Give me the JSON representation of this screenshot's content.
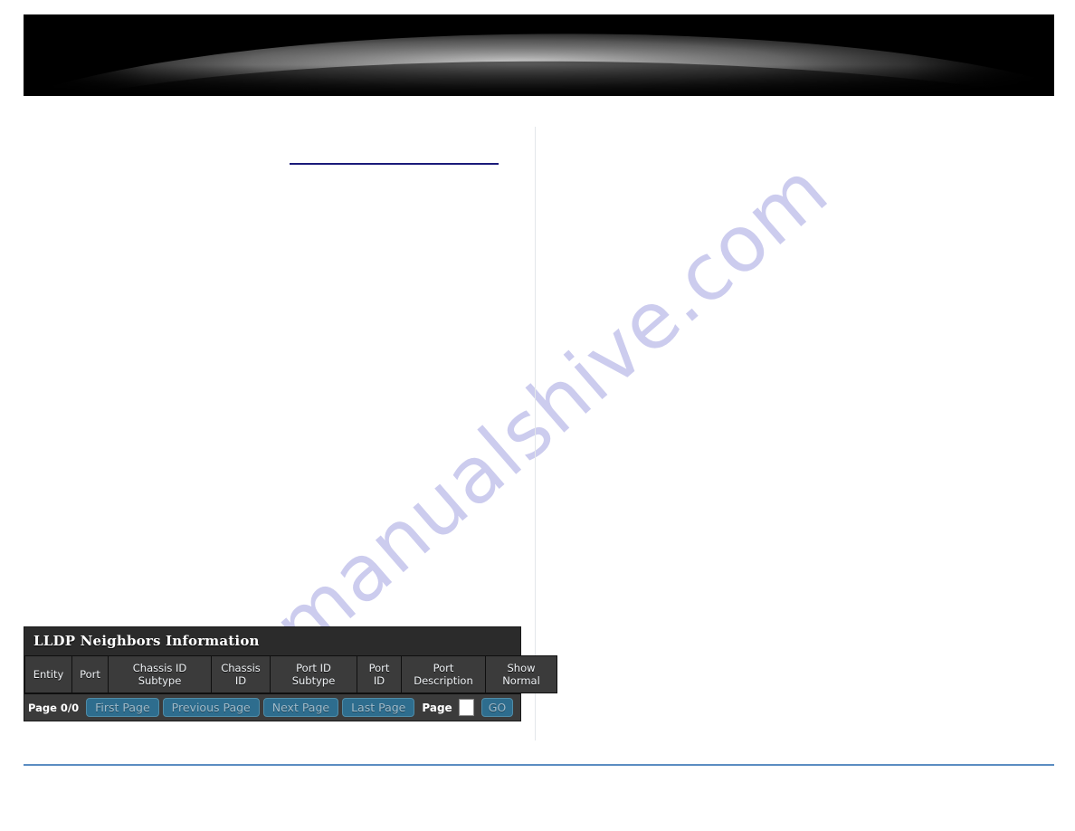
{
  "page": {
    "watermark_text": "manualshive.com",
    "background_color": "#ffffff"
  },
  "banner": {
    "name": "header-banner",
    "background_color": "#000000",
    "accent_color": "#c9c9c9"
  },
  "dividers": {
    "nav_rule_color": "#1b1b7a",
    "column_divider_color": "#e3e7ea",
    "footer_rule_color": "#5b8dc2"
  },
  "lldp_panel": {
    "title": "LLDP Neighbors Information",
    "title_bg": "#2b2b2b",
    "header_bg": "#3b3b3b",
    "columns": [
      {
        "label": "Entity"
      },
      {
        "label": "Port"
      },
      {
        "label": "Chassis ID\nSubtype",
        "line1": "Chassis ID",
        "line2": "Subtype"
      },
      {
        "label": "Chassis\nID",
        "line1": "Chassis",
        "line2": "ID"
      },
      {
        "label": "Port ID\nSubtype",
        "line1": "Port ID",
        "line2": "Subtype"
      },
      {
        "label": "Port\nID",
        "line1": "Port",
        "line2": "ID"
      },
      {
        "label": "Port\nDescription",
        "line1": "Port",
        "line2": "Description"
      },
      {
        "label": "Show\nNormal",
        "line1": "Show",
        "line2": "Normal"
      }
    ],
    "rows": [],
    "pagination": {
      "page_count_label": "Page 0/0",
      "first_page_label": "First Page",
      "previous_page_label": "Previous Page",
      "next_page_label": "Next Page",
      "last_page_label": "Last Page",
      "page_label": "Page",
      "page_input_value": "",
      "page_input_placeholder": "",
      "go_label": "GO",
      "button_bg": "#2e6d8e",
      "button_text_color": "#9fb9c8"
    }
  }
}
